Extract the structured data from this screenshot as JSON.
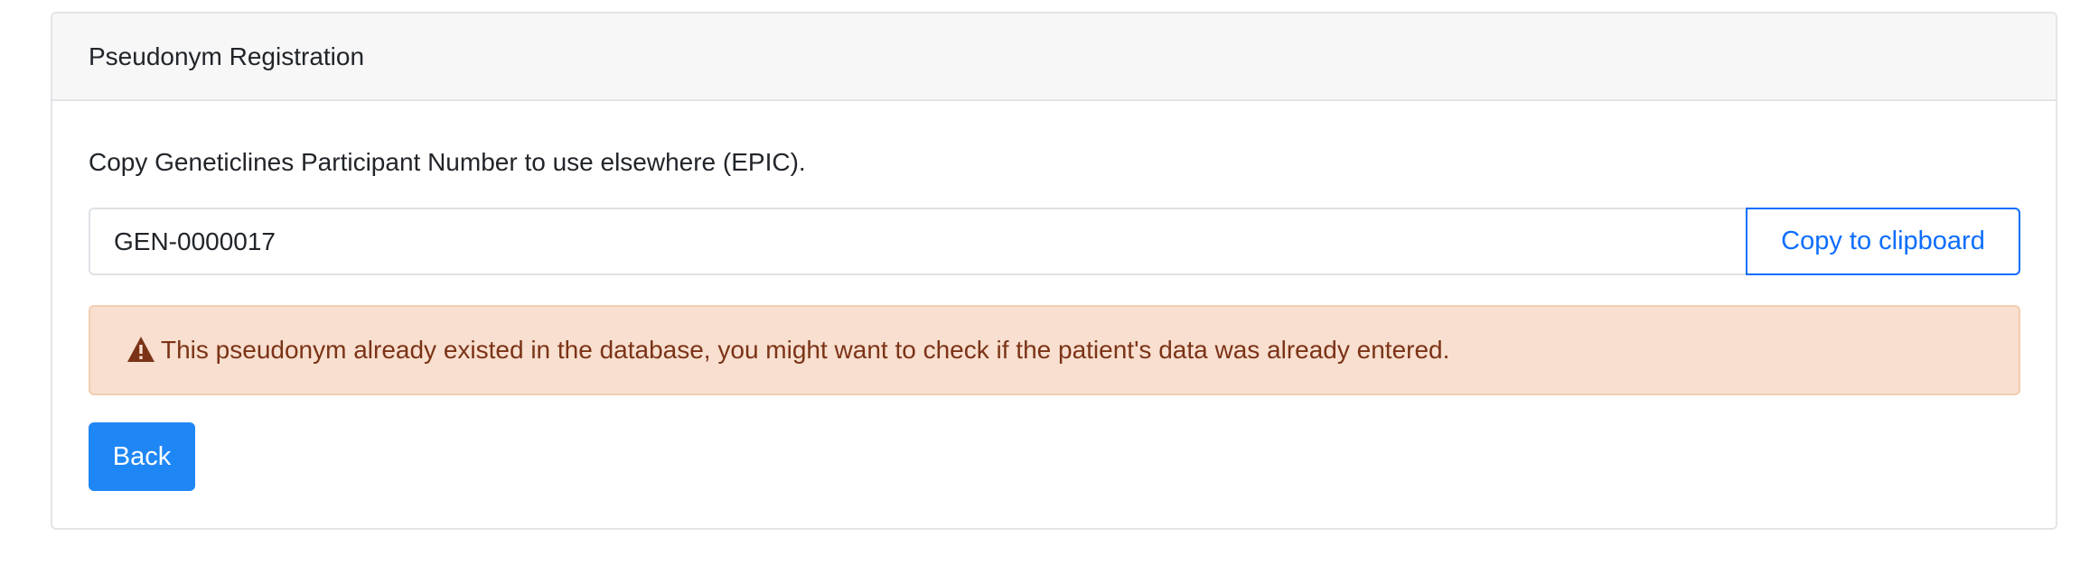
{
  "card": {
    "header_title": "Pseudonym Registration"
  },
  "body": {
    "intro_text": "Copy Geneticlines Participant Number to use elsewhere (EPIC).",
    "participant_number_value": "GEN-0000017",
    "copy_button_label": "Copy to clipboard",
    "alert": {
      "icon": "warning-triangle-icon",
      "text": "This pseudonym already existed in the database, you might want to check if the patient's data was already entered."
    },
    "back_button_label": "Back"
  },
  "colors": {
    "primary": "#1f87f5",
    "link_blue": "#0d6efd",
    "alert_background": "#f8dfcf",
    "alert_text": "#7b3317",
    "header_background": "#f7f7f8"
  }
}
